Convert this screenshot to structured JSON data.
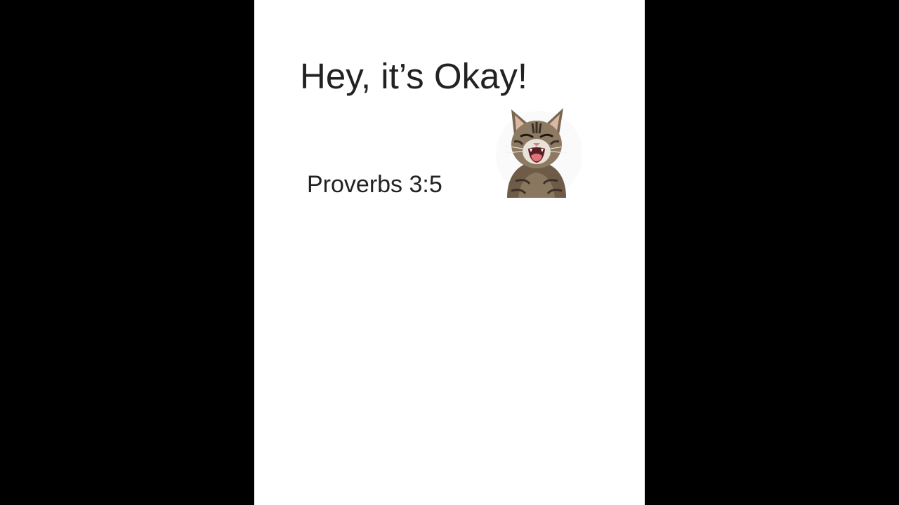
{
  "document": {
    "title": "Hey, it’s Okay!",
    "reference": "Proverbs 3:5"
  },
  "illustration": {
    "icon": "laughing-kitten-icon"
  },
  "colors": {
    "letterbox": "#000000",
    "page": "#ffffff",
    "text": "#222222"
  }
}
